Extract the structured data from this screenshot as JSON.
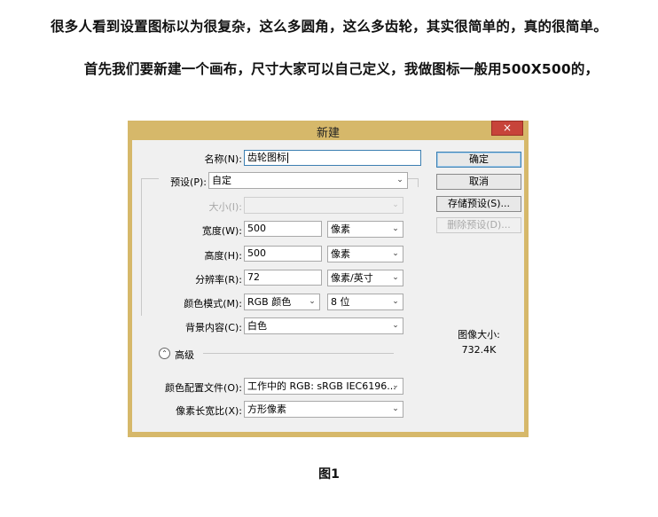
{
  "article": {
    "line1": "很多人看到设置图标以为很复杂，这么多圆角，这么多齿轮，其实很简单的，真的很简单。",
    "line2": "首先我们要新建一个画布，尺寸大家可以自己定义，我做图标一般用500X500的，",
    "caption": "图1"
  },
  "dialog": {
    "title": "新建",
    "close_glyph": "×",
    "name_label": "名称(N):",
    "name_value": "齿轮图标",
    "preset_label": "预设(P):",
    "preset_value": "自定",
    "size_label": "大小(I):",
    "size_value": "",
    "width_label": "宽度(W):",
    "width_value": "500",
    "width_unit": "像素",
    "height_label": "高度(H):",
    "height_value": "500",
    "height_unit": "像素",
    "resolution_label": "分辨率(R):",
    "resolution_value": "72",
    "resolution_unit": "像素/英寸",
    "color_mode_label": "颜色模式(M):",
    "color_mode_value": "RGB 颜色",
    "bit_depth_value": "8 位",
    "background_label": "背景内容(C):",
    "background_value": "白色",
    "advanced_label": "高级",
    "profile_label": "颜色配置文件(O):",
    "profile_value": "工作中的 RGB: sRGB IEC6196...",
    "aspect_label": "像素长宽比(X):",
    "aspect_value": "方形像素",
    "image_size_label": "图像大小:",
    "image_size_value": "732.4K",
    "buttons": {
      "ok": "确定",
      "cancel": "取消",
      "save_preset": "存储预设(S)...",
      "delete_preset": "删除预设(D)..."
    }
  },
  "colors": {
    "frame": "#d6b86a",
    "close": "#c7443a",
    "client": "#f0f0f0",
    "focus": "#3c7fb1"
  }
}
